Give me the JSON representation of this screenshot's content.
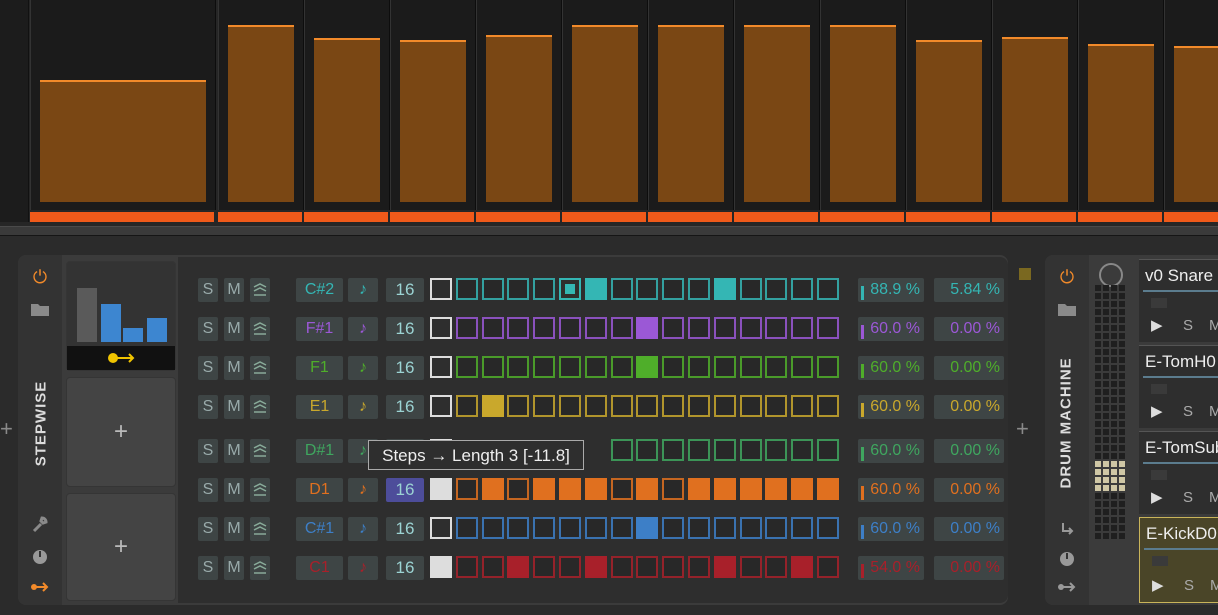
{
  "clip_levels": [
    0.63,
    0.92,
    0.85,
    0.84,
    0.87,
    0.92,
    0.92,
    0.92,
    0.92,
    0.84,
    0.86,
    0.82,
    0.81
  ],
  "stepwise": {
    "title": "STEPWISE",
    "add_symbol": "+",
    "tooltip": "Steps → Length 3 [-11.8]",
    "rows": [
      {
        "s": "S",
        "m": "M",
        "note": "C#2",
        "count": "16",
        "pct1": "88.9 %",
        "pct2": "5.84 %",
        "color": "#34b6b4",
        "cells": [
          2,
          0,
          0,
          0,
          0,
          3,
          1,
          0,
          0,
          0,
          0,
          1,
          0,
          0,
          0,
          0
        ]
      },
      {
        "s": "S",
        "m": "M",
        "note": "F#1",
        "count": "16",
        "pct1": "60.0 %",
        "pct2": "0.00 %",
        "color": "#9b58d6",
        "cells": [
          2,
          0,
          0,
          0,
          0,
          0,
          0,
          0,
          1,
          0,
          0,
          0,
          0,
          0,
          0,
          0
        ]
      },
      {
        "s": "S",
        "m": "M",
        "note": "F1",
        "count": "16",
        "pct1": "60.0 %",
        "pct2": "0.00 %",
        "color": "#4fae2a",
        "cells": [
          2,
          0,
          0,
          0,
          0,
          0,
          0,
          0,
          1,
          0,
          0,
          0,
          0,
          0,
          0,
          0
        ]
      },
      {
        "s": "S",
        "m": "M",
        "note": "E1",
        "count": "16",
        "pct1": "60.0 %",
        "pct2": "0.00 %",
        "color": "#c9a82c",
        "cells": [
          2,
          0,
          1,
          0,
          0,
          0,
          0,
          0,
          0,
          0,
          0,
          0,
          0,
          0,
          0,
          0
        ]
      },
      {
        "s": "S",
        "m": "M",
        "note": "D#1",
        "count": "16",
        "pct1": "60.0 %",
        "pct2": "0.00 %",
        "color": "#3fa65f",
        "cells": [
          2,
          0,
          0,
          0,
          0,
          0,
          0,
          0,
          0,
          0,
          0,
          0,
          0,
          0,
          0,
          0
        ]
      },
      {
        "s": "S",
        "m": "M",
        "note": "D1",
        "count": "16",
        "pct1": "60.0 %",
        "pct2": "0.00 %",
        "color": "#e0701f",
        "cells": [
          4,
          0,
          1,
          0,
          1,
          1,
          1,
          0,
          1,
          0,
          1,
          1,
          1,
          1,
          1,
          1
        ]
      },
      {
        "s": "S",
        "m": "M",
        "note": "C#1",
        "count": "16",
        "pct1": "60.0 %",
        "pct2": "0.00 %",
        "color": "#3d7fc7",
        "cells": [
          2,
          0,
          0,
          0,
          0,
          0,
          0,
          0,
          1,
          0,
          0,
          0,
          0,
          0,
          0,
          0
        ]
      },
      {
        "s": "S",
        "m": "M",
        "note": "C1",
        "count": "16",
        "pct1": "54.0 %",
        "pct2": "0.00 %",
        "color": "#a8202a",
        "cells": [
          4,
          0,
          0,
          1,
          0,
          0,
          1,
          0,
          0,
          0,
          0,
          1,
          0,
          0,
          1,
          0
        ]
      }
    ]
  },
  "drum": {
    "title": "DRUM MACHINE",
    "slots": [
      {
        "name": "v0 Snare",
        "play": "▶",
        "s": "S",
        "m": "M"
      },
      {
        "name": "E-TomH0",
        "play": "▶",
        "s": "S",
        "m": "M"
      },
      {
        "name": "E-TomSub",
        "play": "▶",
        "s": "S",
        "m": "M"
      },
      {
        "name": "E-KickD0",
        "play": "▶",
        "s": "S",
        "m": "M"
      }
    ]
  },
  "colors": {
    "accent": "#f05a1a",
    "clip": "#7a4714",
    "clip_line": "#f28a2a"
  }
}
